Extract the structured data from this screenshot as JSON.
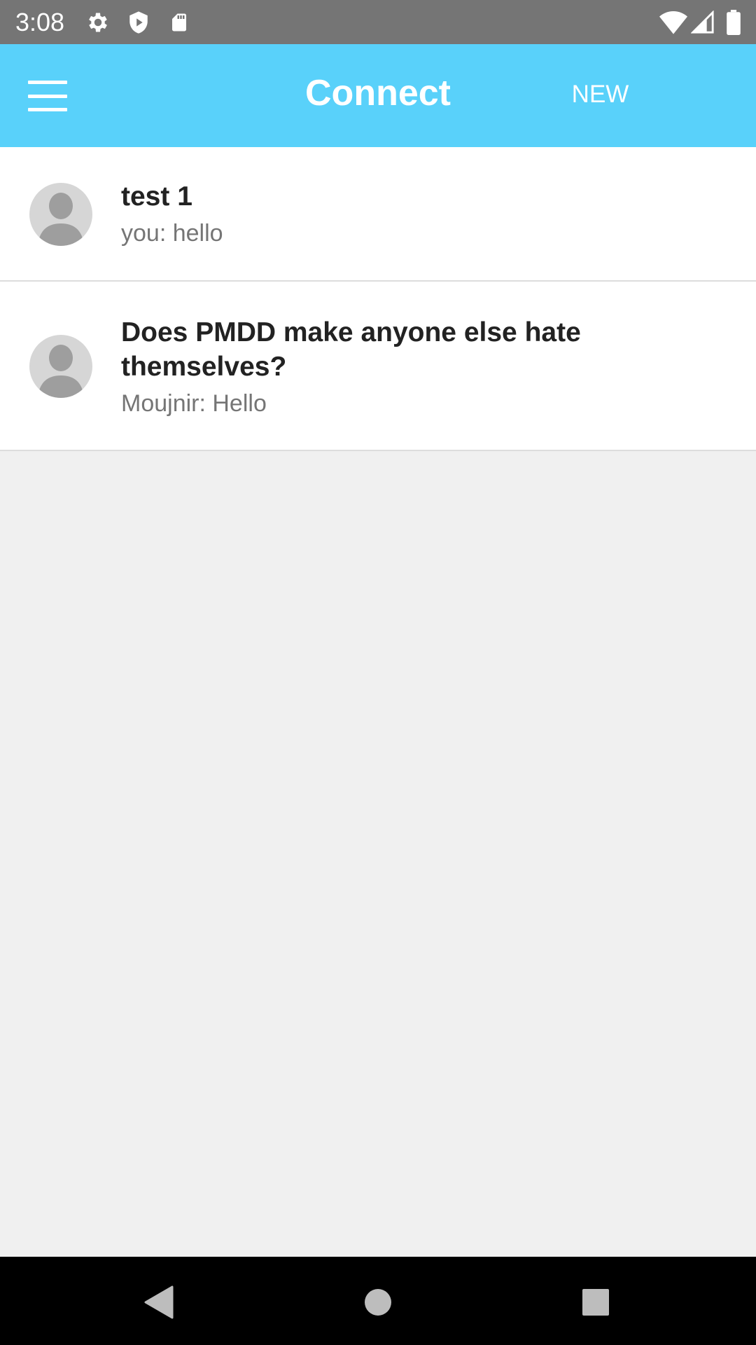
{
  "status_bar": {
    "time": "3:08",
    "icons": [
      "gear-icon",
      "shield-icon",
      "sd-card-icon",
      "wifi-icon",
      "signal-icon",
      "battery-icon"
    ]
  },
  "app_bar": {
    "title": "Connect",
    "new_label": "NEW",
    "background_color": "#59d1fa"
  },
  "conversations": [
    {
      "title": "test 1",
      "last_message": "you: hello"
    },
    {
      "title": "Does PMDD make anyone else hate themselves?",
      "last_message": "Moujnir: Hello"
    }
  ],
  "nav_bar": {
    "icons": [
      "back-icon",
      "home-icon",
      "recents-icon"
    ]
  }
}
